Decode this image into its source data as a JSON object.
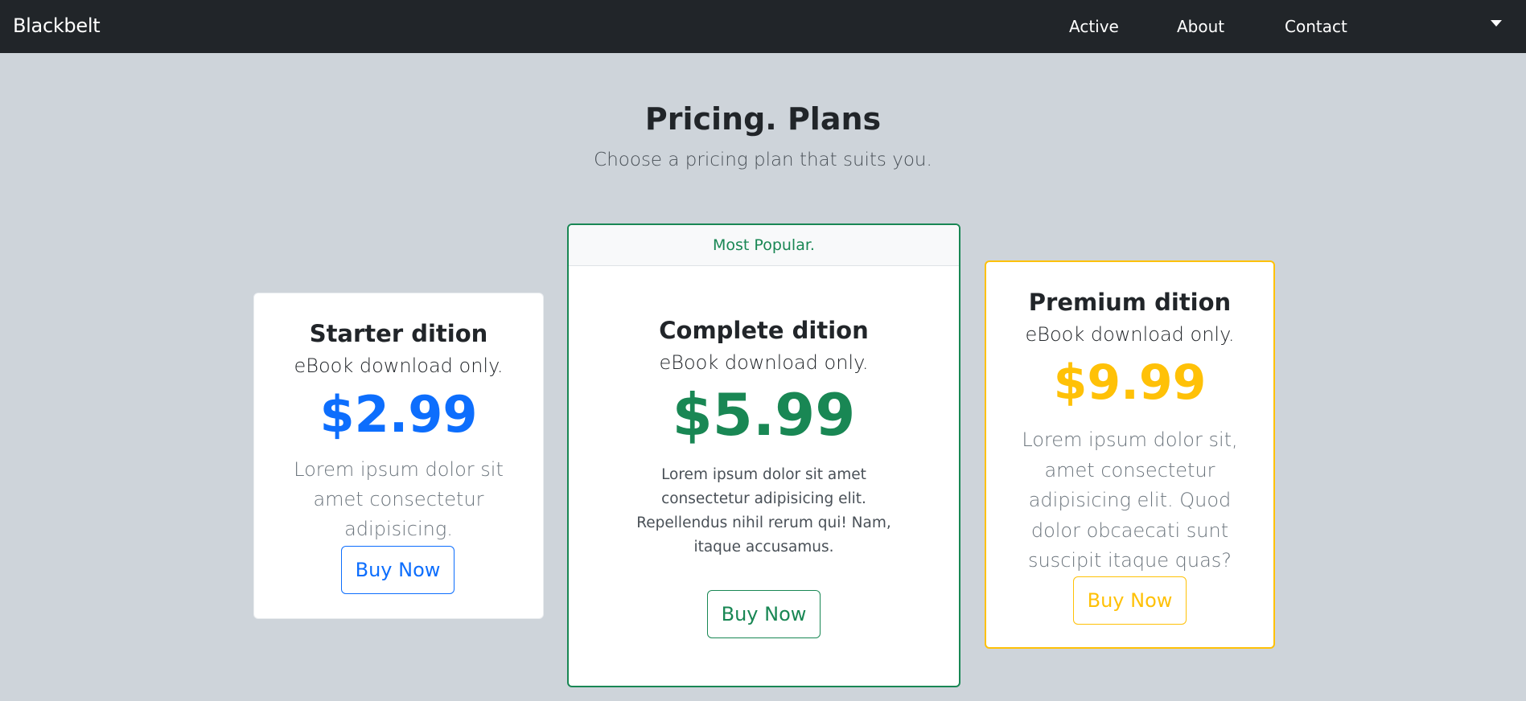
{
  "navbar": {
    "brand": "Blackbelt",
    "links": [
      {
        "label": "Active"
      },
      {
        "label": "About"
      },
      {
        "label": "Contact"
      }
    ],
    "dropdown_icon": "caret-down-icon"
  },
  "header": {
    "title": "Pricing. Plans",
    "subtitle": "Choose a pricing plan that suits you."
  },
  "plans": [
    {
      "title": "Starter dition",
      "subtitle": "eBook download only.",
      "price": "$2.99",
      "description": "Lorem ipsum dolor sit amet consectetur adipisicing.",
      "button": "Buy Now",
      "accent": "#0d6efd"
    },
    {
      "badge": "Most Popular.",
      "title": "Complete dition",
      "subtitle": "eBook download only.",
      "price": "$5.99",
      "description": "Lorem ipsum dolor sit amet consectetur adipisicing elit. Repellendus nihil rerum qui! Nam, itaque accusamus.",
      "button": "Buy Now",
      "accent": "#198754"
    },
    {
      "title": "Premium dition",
      "subtitle": "eBook download only.",
      "price": "$9.99",
      "description": "Lorem ipsum dolor sit, amet consectetur adipisicing elit. Quod dolor obcaecati sunt suscipit itaque quas?",
      "button": "Buy Now",
      "accent": "#ffc107"
    }
  ],
  "colors": {
    "navbar_bg": "#212529",
    "page_bg": "#ced4da",
    "card_bg": "#ffffff"
  }
}
